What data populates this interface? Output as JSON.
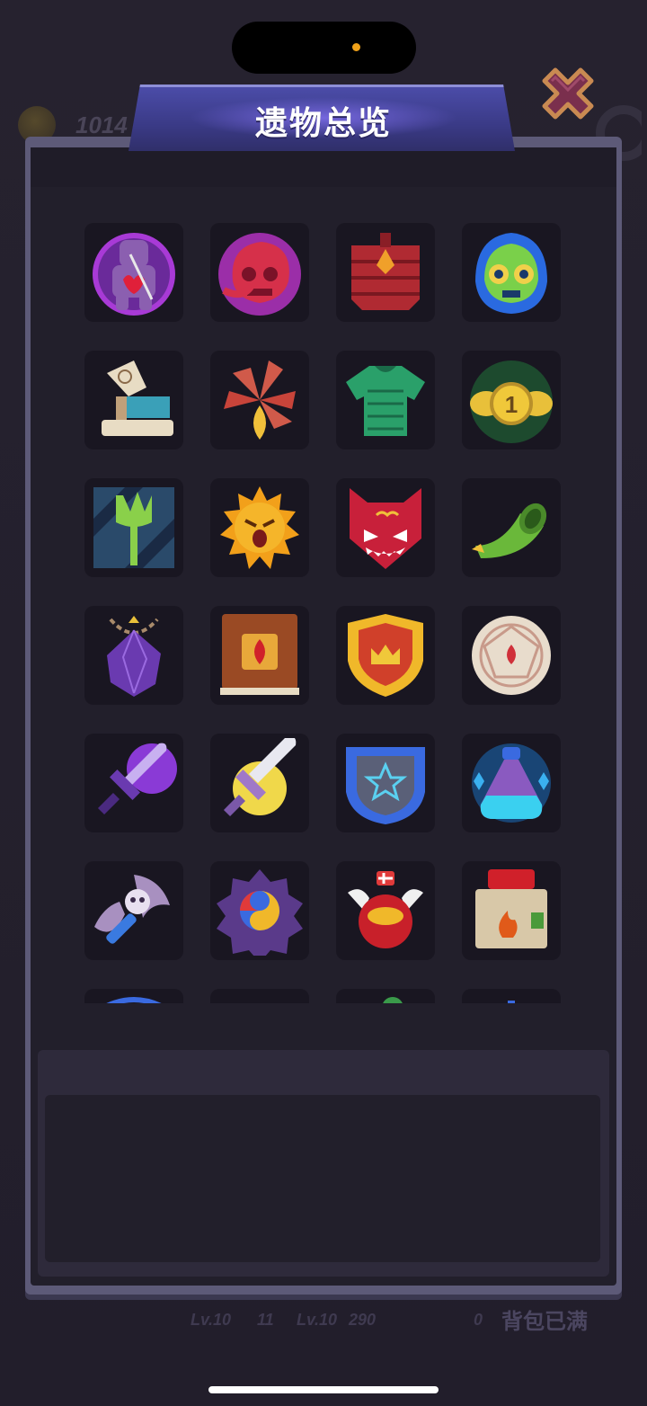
{
  "background": {
    "coin_count": "1014",
    "bottom_bar": [
      {
        "level": "Lv.10",
        "count": "11"
      },
      {
        "level": "Lv.10",
        "count": "290"
      },
      {
        "level": "",
        "count": "0"
      }
    ],
    "bag_status": "背包已满"
  },
  "panel": {
    "title": "遗物总览",
    "close_icon": "close-x-icon"
  },
  "relics": [
    {
      "icon": "voodoo-doll-icon"
    },
    {
      "icon": "red-skull-spirit-icon"
    },
    {
      "icon": "red-tribal-armor-icon"
    },
    {
      "icon": "blue-flame-mask-icon"
    },
    {
      "icon": "wooden-horse-icon"
    },
    {
      "icon": "phoenix-feather-icon"
    },
    {
      "icon": "green-scale-shirt-icon"
    },
    {
      "icon": "winged-gold-medal-icon"
    },
    {
      "icon": "green-trident-icon"
    },
    {
      "icon": "angry-sun-icon"
    },
    {
      "icon": "demon-shield-icon"
    },
    {
      "icon": "green-horn-icon"
    },
    {
      "icon": "amethyst-necklace-icon"
    },
    {
      "icon": "ancient-tome-icon"
    },
    {
      "icon": "gold-crown-shield-icon"
    },
    {
      "icon": "rune-disc-icon"
    },
    {
      "icon": "purple-sword-icon"
    },
    {
      "icon": "glowing-dagger-icon"
    },
    {
      "icon": "star-shield-icon"
    },
    {
      "icon": "mana-potion-icon"
    },
    {
      "icon": "skull-axe-icon"
    },
    {
      "icon": "yin-yang-orb-icon"
    },
    {
      "icon": "winged-health-potion-icon"
    },
    {
      "icon": "fire-crate-icon"
    },
    {
      "icon": "partial-relic-icon"
    },
    {
      "icon": "partial-relic-icon"
    },
    {
      "icon": "partial-relic-icon"
    },
    {
      "icon": "partial-relic-icon"
    }
  ],
  "description": {
    "text": ""
  },
  "colors": {
    "accent": "#4b4ca8",
    "panel_bg": "#221f2b",
    "close": "#7a2f4d"
  }
}
